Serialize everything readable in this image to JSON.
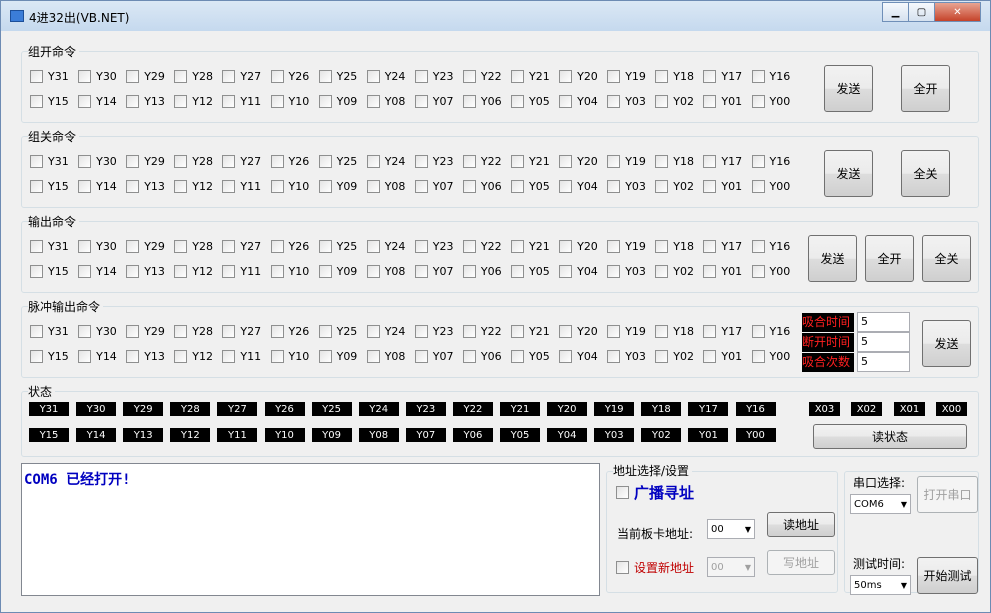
{
  "window": {
    "title": "4进32出(VB.NET)",
    "minimize": "▁",
    "maximize": "▢",
    "close": "✕"
  },
  "groups": {
    "open": {
      "label": "组开命令",
      "send": "发送",
      "all": "全开"
    },
    "close": {
      "label": "组关命令",
      "send": "发送",
      "all": "全关"
    },
    "output": {
      "label": "输出命令",
      "send": "发送",
      "all_on": "全开",
      "all_off": "全关"
    },
    "pulse": {
      "label": "脉冲输出命令",
      "send": "发送",
      "on_time_label": "吸合时间",
      "off_time_label": "断开时间",
      "count_label": "吸合次数",
      "on_time": "5",
      "off_time": "5",
      "count": "5"
    }
  },
  "row1": [
    "Y31",
    "Y30",
    "Y29",
    "Y28",
    "Y27",
    "Y26",
    "Y25",
    "Y24",
    "Y23",
    "Y22",
    "Y21",
    "Y20",
    "Y19",
    "Y18",
    "Y17",
    "Y16"
  ],
  "row2": [
    "Y15",
    "Y14",
    "Y13",
    "Y12",
    "Y11",
    "Y10",
    "Y09",
    "Y08",
    "Y07",
    "Y06",
    "Y05",
    "Y04",
    "Y03",
    "Y02",
    "Y01",
    "Y00"
  ],
  "status": {
    "label": "状态",
    "inputs": [
      "X03",
      "X02",
      "X01",
      "X00"
    ],
    "read_button": "读状态"
  },
  "log": {
    "text": "COM6 已经打开!"
  },
  "address": {
    "label": "地址选择/设置",
    "broadcast": "广播寻址",
    "current_label": "当前板卡地址:",
    "current_value": "00",
    "read_button": "读地址",
    "set_new": "设置新地址",
    "new_value": "00",
    "write_button": "写地址"
  },
  "serial": {
    "label": "串口选择:",
    "port": "COM6",
    "open_button": "打开串口",
    "test_label": "测试时间:",
    "test_value": "50ms",
    "test_button": "开始测试"
  }
}
